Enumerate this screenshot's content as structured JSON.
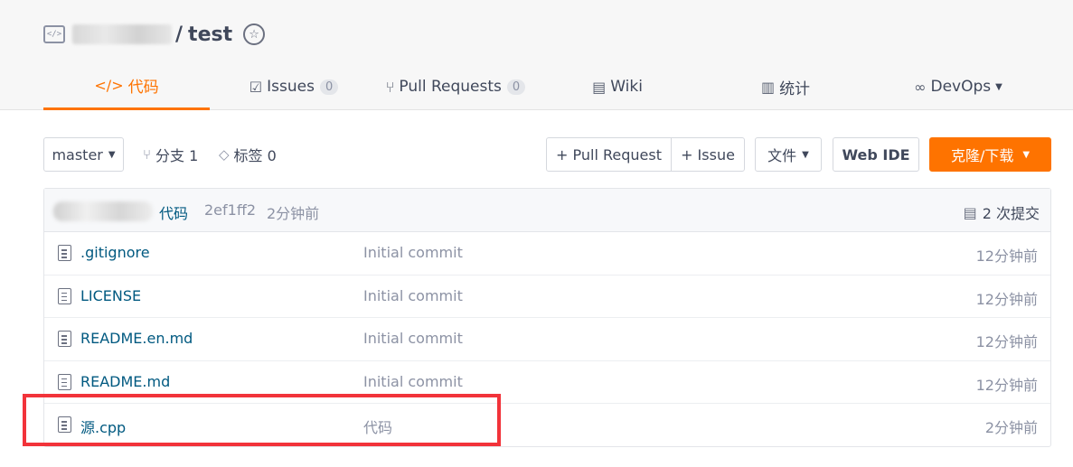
{
  "repo": {
    "name": "test",
    "slash": "/"
  },
  "tabs": [
    {
      "label": "代码",
      "icon": "code-icon"
    },
    {
      "label": "Issues",
      "icon": "issues-icon",
      "count": "0"
    },
    {
      "label": "Pull Requests",
      "icon": "pull-request-icon",
      "count": "0"
    },
    {
      "label": "Wiki",
      "icon": "wiki-icon"
    },
    {
      "label": "统计",
      "icon": "stats-icon"
    },
    {
      "label": "DevOps",
      "icon": "devops-icon"
    }
  ],
  "toolbar": {
    "branch": "master",
    "branches_label": "分支 1",
    "tags_label": "标签 0",
    "pull_request_label": "+ Pull Request",
    "issue_label": "+ Issue",
    "file_label": "文件",
    "webide_label": "Web IDE",
    "clone_label": "克隆/下载"
  },
  "last_commit": {
    "message": "代码",
    "sha": "2ef1ff2",
    "time": "2分钟前",
    "count_label": "2 次提交"
  },
  "files": [
    {
      "name": ".gitignore",
      "message": "Initial commit",
      "time": "12分钟前"
    },
    {
      "name": "LICENSE",
      "message": "Initial commit",
      "time": "12分钟前"
    },
    {
      "name": "README.en.md",
      "message": "Initial commit",
      "time": "12分钟前"
    },
    {
      "name": "README.md",
      "message": "Initial commit",
      "time": "12分钟前"
    },
    {
      "name": "源.cpp",
      "message": "代码",
      "time": "2分钟前"
    }
  ],
  "colors": {
    "accent": "#fe7300",
    "link": "#005980",
    "highlight": "#f2333a"
  }
}
